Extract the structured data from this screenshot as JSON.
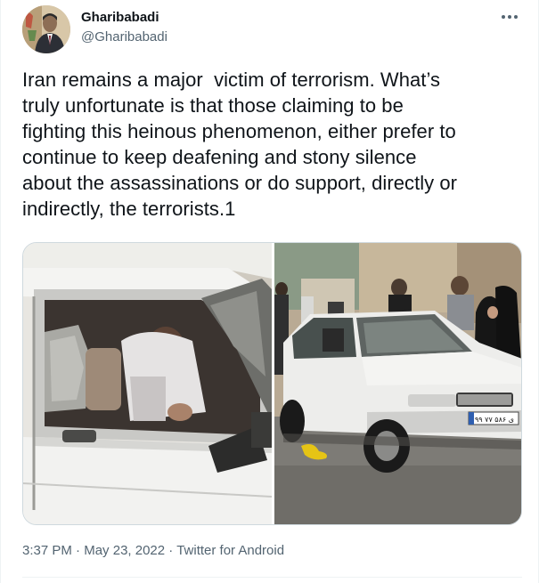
{
  "author": {
    "display_name": "Gharibabadi",
    "handle": "@Gharibabadi"
  },
  "more_icon": "more-horizontal-icon",
  "tweet": {
    "text": "Iran remains a major  victim of terrorism. What’s\ntruly unfortunate is that those claiming to be\nfighting this heinous phenomenon, either prefer to\ncontinue to keep deafening and stony silence\nabout the assassinations or do support, directly or\nindirectly, the terrorists.1"
  },
  "media": {
    "photos": [
      {
        "alt": "photo-damaged-car-door"
      },
      {
        "alt": "photo-white-car-street-crowd",
        "plate": "۹۹ ی ۵۸۶ ۷۷"
      }
    ]
  },
  "meta": {
    "time": "3:37 PM",
    "separator1": " · ",
    "date": "May 23, 2022",
    "separator2": " · ",
    "source": "Twitter for Android"
  },
  "colors": {
    "text": "#0f1419",
    "secondary": "#536471",
    "border": "#cfd9de"
  }
}
